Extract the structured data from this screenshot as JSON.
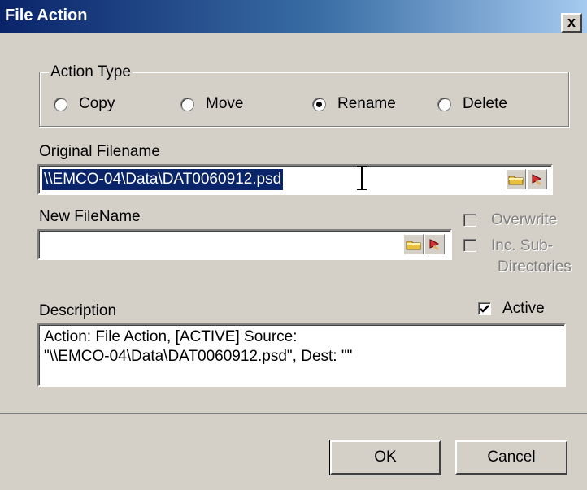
{
  "window": {
    "title": "File Action",
    "close_glyph": "x"
  },
  "action_type": {
    "label": "Action Type",
    "options": [
      {
        "label": "Copy",
        "selected": false
      },
      {
        "label": "Move",
        "selected": false
      },
      {
        "label": "Rename",
        "selected": true
      },
      {
        "label": "Delete",
        "selected": false
      }
    ]
  },
  "original": {
    "label": "Original Filename",
    "value": "\\\\EMCO-04\\Data\\DAT0060912.psd"
  },
  "new_file": {
    "label": "New FileName",
    "value": ""
  },
  "options": {
    "overwrite": {
      "label": "Overwrite",
      "checked": false,
      "enabled": false
    },
    "inc_sub": {
      "label_line1": "Inc. Sub-",
      "label_line2": "Directories",
      "checked": false,
      "enabled": false
    }
  },
  "description": {
    "label": "Description",
    "active_label": "Active",
    "active_checked": true,
    "text_line1": "Action: File Action, [ACTIVE] Source:",
    "text_line2": "\"\\\\EMCO-04\\Data\\DAT0060912.psd\", Dest: \"\""
  },
  "buttons": {
    "ok": "OK",
    "cancel": "Cancel"
  },
  "colors": {
    "selection": "#0a246a",
    "face": "#d4d0c8",
    "title_start": "#0a246a"
  },
  "icons": [
    "folder-open-icon",
    "clear-edit-icon"
  ]
}
